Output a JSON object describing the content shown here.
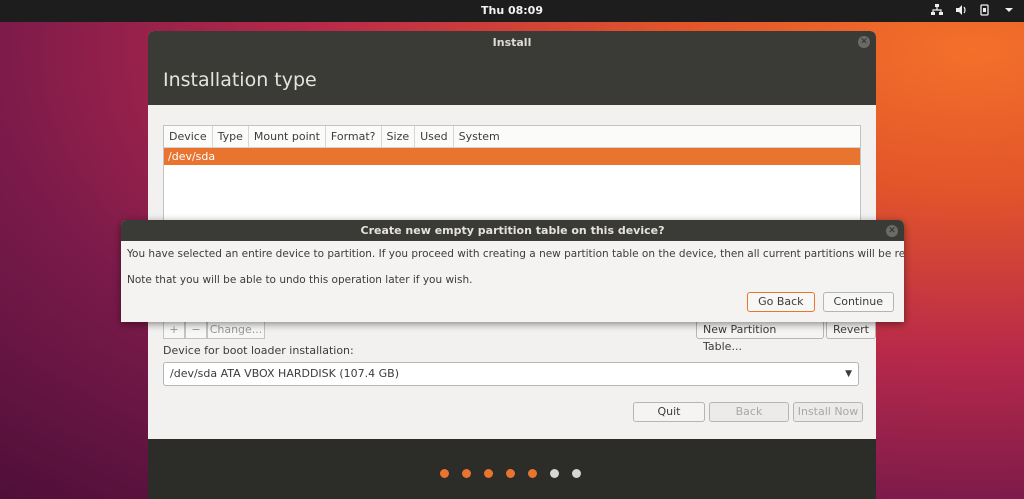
{
  "topbar": {
    "clock": "Thu 08:09"
  },
  "window": {
    "title": "Install",
    "page_title": "Installation type"
  },
  "partition_table": {
    "columns": [
      "Device",
      "Type",
      "Mount point",
      "Format?",
      "Size",
      "Used",
      "System"
    ],
    "rows": [
      {
        "device": "/dev/sda"
      }
    ]
  },
  "partition_toolbar": {
    "add": "+",
    "remove": "−",
    "change": "Change...",
    "new_table": "New Partition Table...",
    "revert": "Revert"
  },
  "boot_loader": {
    "label": "Device for boot loader installation:",
    "value": "/dev/sda ATA VBOX HARDDISK (107.4 GB)"
  },
  "nav_buttons": {
    "quit": "Quit",
    "back": "Back",
    "install_now": "Install Now"
  },
  "dialog": {
    "title": "Create new empty partition table on this device?",
    "message": "You have selected an entire device to partition. If you proceed with creating a new partition table on the device, then all current partitions will be removed.",
    "note": "Note that you will be able to undo this operation later if you wish.",
    "go_back": "Go Back",
    "continue": "Continue"
  },
  "progress": {
    "total_steps": 7,
    "completed_steps": 5
  },
  "colors": {
    "accent": "#e8742f",
    "dot_done": "#e8742f",
    "dot_pending": "#d8d6d2"
  }
}
